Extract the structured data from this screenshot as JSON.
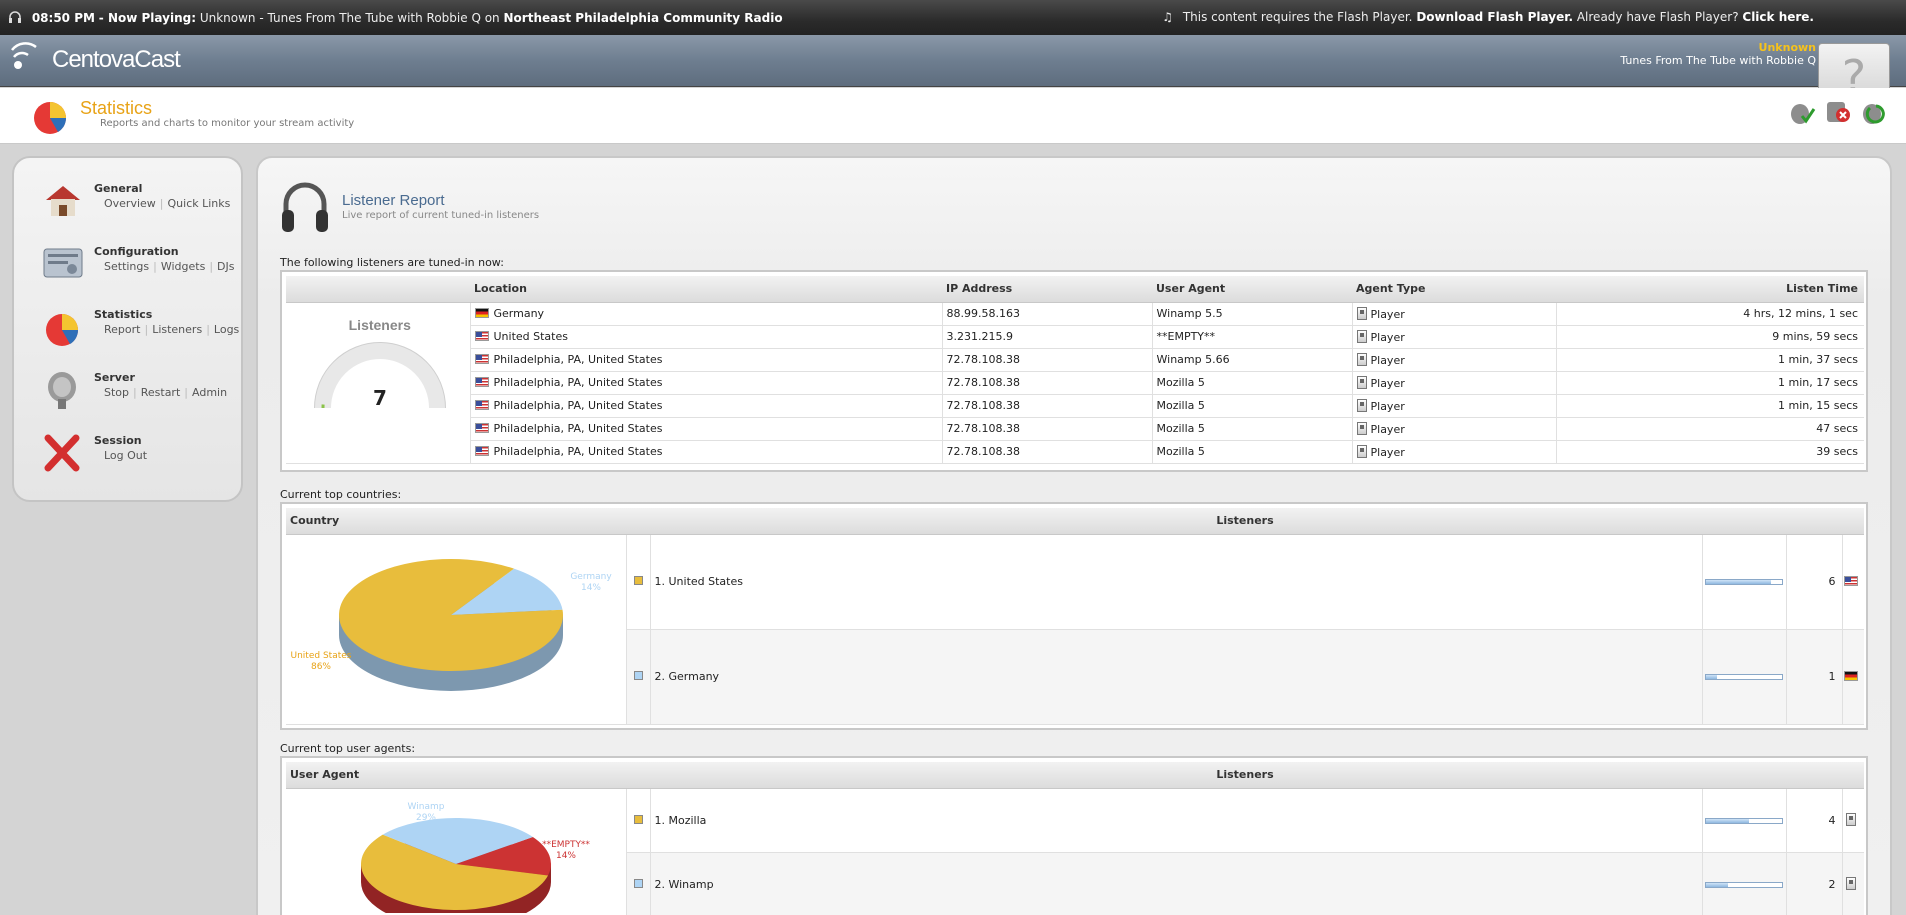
{
  "topbar": {
    "time": "08:50 PM",
    "now_playing_label": "- Now Playing:",
    "track": "Unknown - Tunes From The Tube with Robbie Q",
    "on": "on",
    "station": "Northeast Philadelphia Community Radio",
    "flash_msg": "This content requires the Flash Player.",
    "flash_download": "Download Flash Player.",
    "flash_have": "Already have Flash Player?",
    "flash_click": "Click here."
  },
  "header": {
    "logo": "CentovaCast",
    "np_artist": "Unknown",
    "np_title": "Tunes From The Tube with Robbie Q",
    "flash_placeholder": "?"
  },
  "page": {
    "title": "Statistics",
    "subtitle": "Reports and charts to monitor your stream activity"
  },
  "sidebar": {
    "items": [
      {
        "title": "General",
        "links": [
          "Overview",
          "Quick Links"
        ]
      },
      {
        "title": "Configuration",
        "links": [
          "Settings",
          "Widgets",
          "DJs"
        ]
      },
      {
        "title": "Statistics",
        "links": [
          "Report",
          "Listeners",
          "Logs"
        ]
      },
      {
        "title": "Server",
        "links": [
          "Stop",
          "Restart",
          "Admin"
        ]
      },
      {
        "title": "Session",
        "links": [
          "Log Out"
        ]
      }
    ]
  },
  "report": {
    "title": "Listener Report",
    "subtitle": "Live report of current tuned-in listeners",
    "caption": "The following listeners are tuned-in now:",
    "gauge_title": "Listeners",
    "gauge_value": "7",
    "gauge_level": 0.02,
    "columns": [
      "Location",
      "IP Address",
      "User Agent",
      "Agent Type",
      "Listen Time"
    ],
    "rows": [
      {
        "flag": "de",
        "location": "Germany",
        "ip": "88.99.58.163",
        "agent": "Winamp 5.5",
        "type": "Player",
        "time": "4 hrs, 12 mins, 1 sec"
      },
      {
        "flag": "us",
        "location": "United States",
        "ip": "3.231.215.9",
        "agent": "**EMPTY**",
        "type": "Player",
        "time": "9 mins, 59 secs"
      },
      {
        "flag": "us",
        "location": "Philadelphia, PA, United States",
        "ip": "72.78.108.38",
        "agent": "Winamp 5.66",
        "type": "Player",
        "time": "1 min, 37 secs"
      },
      {
        "flag": "us",
        "location": "Philadelphia, PA, United States",
        "ip": "72.78.108.38",
        "agent": "Mozilla 5",
        "type": "Player",
        "time": "1 min, 17 secs"
      },
      {
        "flag": "us",
        "location": "Philadelphia, PA, United States",
        "ip": "72.78.108.38",
        "agent": "Mozilla 5",
        "type": "Player",
        "time": "1 min, 15 secs"
      },
      {
        "flag": "us",
        "location": "Philadelphia, PA, United States",
        "ip": "72.78.108.38",
        "agent": "Mozilla 5",
        "type": "Player",
        "time": "47 secs"
      },
      {
        "flag": "us",
        "location": "Philadelphia, PA, United States",
        "ip": "72.78.108.38",
        "agent": "Mozilla 5",
        "type": "Player",
        "time": "39 secs"
      }
    ]
  },
  "countries": {
    "caption": "Current top countries:",
    "col1": "Country",
    "col2": "Listeners",
    "rows": [
      {
        "rank_label": "1. United States",
        "count": "6",
        "flag": "us",
        "color": "#e8bd3c",
        "fraction": 0.86
      },
      {
        "rank_label": "2. Germany",
        "count": "1",
        "flag": "de",
        "color": "#aed4f4",
        "fraction": 0.14
      }
    ],
    "pie_labels": [
      {
        "name": "Germany",
        "pct": "14%",
        "color": "#aed4f4"
      },
      {
        "name": "United States",
        "pct": "86%",
        "color": "#e8bd3c"
      }
    ]
  },
  "agents": {
    "caption": "Current top user agents:",
    "col1": "User Agent",
    "col2": "Listeners",
    "rows": [
      {
        "rank_label": "1. Mozilla",
        "count": "4",
        "color": "#e8bd3c",
        "fraction": 0.57
      },
      {
        "rank_label": "2. Winamp",
        "count": "2",
        "color": "#aed4f4",
        "fraction": 0.29
      }
    ],
    "pie_labels": [
      {
        "name": "Winamp",
        "pct": "29%",
        "color": "#aed4f4"
      },
      {
        "name": "**EMPTY**",
        "pct": "14%",
        "color": "#cc3333"
      }
    ]
  }
}
